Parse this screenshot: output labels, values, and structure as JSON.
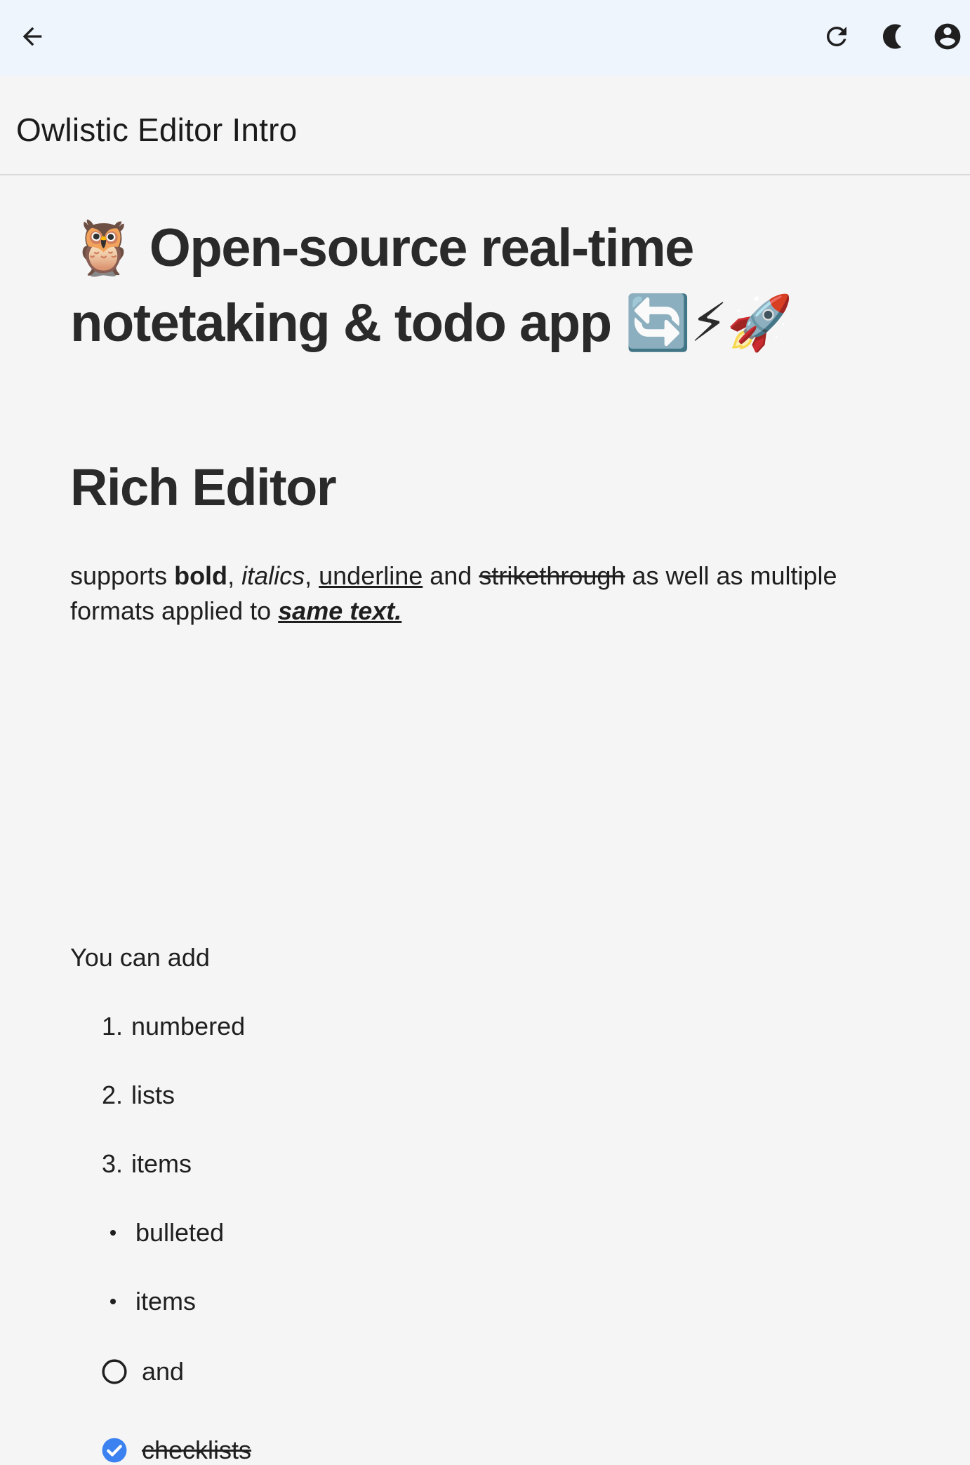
{
  "topbar": {
    "back_icon": "arrow-left-icon",
    "refresh_icon": "refresh-icon",
    "theme_icon": "moon-icon",
    "account_icon": "account-circle-icon",
    "bg_color": "#eef5fd"
  },
  "document": {
    "title": "Owlistic Editor Intro"
  },
  "editor": {
    "heading1": {
      "emoji_owl": "🦉",
      "line1": "Open-source real-time",
      "line2": "notetaking & todo app",
      "emoji_refresh": "🔄",
      "emoji_zap": "⚡",
      "emoji_rocket": "🚀"
    },
    "heading2": "Rich Editor",
    "paragraph": {
      "t1": "supports ",
      "bold": "bold",
      "t2": ", ",
      "italic": "italics",
      "t3": ", ",
      "underline": "underline",
      "t4": " and ",
      "strike": "strikethrough",
      "t5": " as well as multiple formats applied to ",
      "multi": "same text."
    },
    "intro_line": "You can add",
    "numbered_list": [
      {
        "marker": "1.",
        "text": "numbered"
      },
      {
        "marker": "2.",
        "text": "lists"
      },
      {
        "marker": "3.",
        "text": "items"
      }
    ],
    "bulleted_list": [
      {
        "text": "bulleted"
      },
      {
        "text": "items"
      }
    ],
    "checklist": [
      {
        "text": "and",
        "checked": false
      },
      {
        "text": "checklists",
        "checked": true
      }
    ],
    "checkbox_checked_color": "#3b82f0"
  }
}
